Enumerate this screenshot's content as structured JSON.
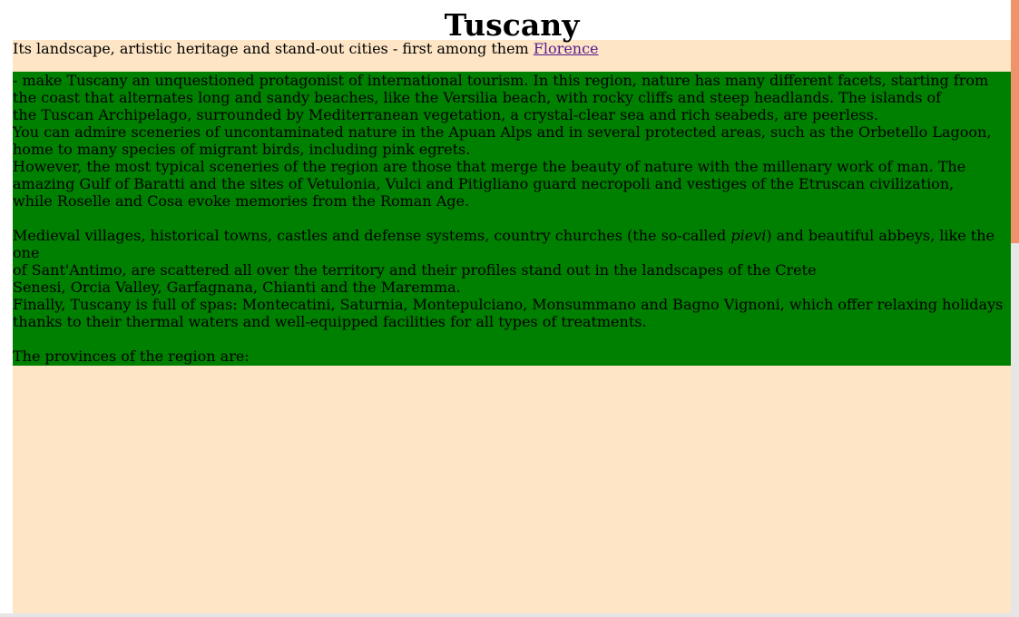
{
  "page": {
    "title": "Tuscany",
    "intro_text": "Its landscape, artistic heritage and stand-out cities - first among them ",
    "intro_link": "Florence",
    "paragraph1": {
      "line1": " - make Tuscany an unquestioned protagonist of international tourism. In this region, nature has many different facets, starting from",
      "line2": "the coast that alternates long and sandy beaches, like the Versilia beach, with rocky cliffs and steep headlands. The islands of",
      "line3": "the Tuscan Archipelago, surrounded by Mediterranean vegetation, a crystal-clear sea and rich seabeds, are peerless.",
      "line4": "You can admire sceneries of uncontaminated nature in the Apuan Alps and in several protected areas, such as the Orbetello Lagoon,",
      "line5": "home to many species of migrant birds, including pink egrets.",
      "line6": "However, the most typical sceneries of the region are those that merge the beauty of nature with the millenary work of man. The",
      "line7": "amazing Gulf of Baratti and the sites of Vetulonia, Vulci and Pitigliano guard necropoli and vestiges of the Etruscan civilization,",
      "line8": "while Roselle and Cosa evoke memories from the Roman Age."
    },
    "paragraph2": {
      "line1_before": "Medieval villages, historical towns, castles and defense systems, country churches (the so-called ",
      "line1_italic": "pievi",
      "line1_after": ") and beautiful abbeys, like the one",
      "line2": "of Sant'Antimo, are scattered all over the territory and their profiles stand out in the landscapes of the Crete",
      "line3": "Senesi, Orcia Valley, Garfagnana, Chianti and the Maremma.",
      "line4": "Finally, Tuscany is full of spas: Montecatini, Saturnia, Montepulciano, Monsummano and Bagno Vignoni, which offer relaxing holidays",
      "line5": "thanks to their thermal waters and well-equipped facilities for all types of treatments."
    },
    "provinces_text": "The provinces of the region are:"
  },
  "colors": {
    "content_background": "#fde5c5",
    "text_block_background": "#008000",
    "link": "#551a8b",
    "scrollbar_thumb": "#f0926a",
    "scrollbar_track": "#e6e6e6"
  }
}
